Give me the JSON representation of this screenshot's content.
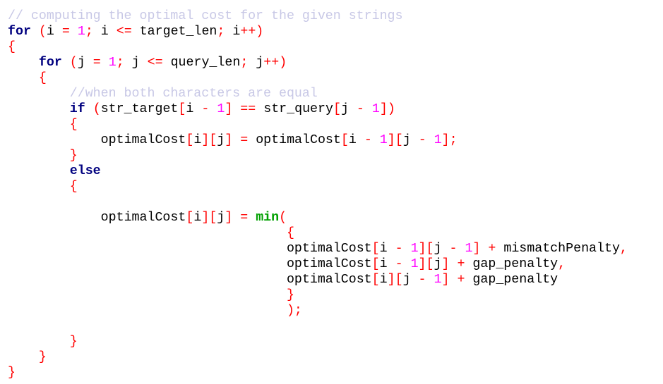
{
  "colors": {
    "keyword": "#00007f",
    "function": "#00a000",
    "number": "#ff00ff",
    "operator": "#ff0000",
    "comment": "#c8c8e6",
    "identifier": "#000000",
    "background": "#ffffff"
  },
  "code_lines": [
    [
      [
        "cmt",
        "// computing the optimal cost for the given strings"
      ]
    ],
    [
      [
        "kw",
        "for"
      ],
      [
        "ws",
        " "
      ],
      [
        "op",
        "("
      ],
      [
        "id",
        "i"
      ],
      [
        "ws",
        " "
      ],
      [
        "op",
        "="
      ],
      [
        "ws",
        " "
      ],
      [
        "num",
        "1"
      ],
      [
        "op",
        ";"
      ],
      [
        "ws",
        " "
      ],
      [
        "id",
        "i"
      ],
      [
        "ws",
        " "
      ],
      [
        "op",
        "<="
      ],
      [
        "ws",
        " "
      ],
      [
        "id",
        "target_len"
      ],
      [
        "op",
        ";"
      ],
      [
        "ws",
        " "
      ],
      [
        "id",
        "i"
      ],
      [
        "op",
        "++)"
      ]
    ],
    [
      [
        "op",
        "{"
      ]
    ],
    [
      [
        "ws",
        "    "
      ],
      [
        "kw",
        "for"
      ],
      [
        "ws",
        " "
      ],
      [
        "op",
        "("
      ],
      [
        "id",
        "j"
      ],
      [
        "ws",
        " "
      ],
      [
        "op",
        "="
      ],
      [
        "ws",
        " "
      ],
      [
        "num",
        "1"
      ],
      [
        "op",
        ";"
      ],
      [
        "ws",
        " "
      ],
      [
        "id",
        "j"
      ],
      [
        "ws",
        " "
      ],
      [
        "op",
        "<="
      ],
      [
        "ws",
        " "
      ],
      [
        "id",
        "query_len"
      ],
      [
        "op",
        ";"
      ],
      [
        "ws",
        " "
      ],
      [
        "id",
        "j"
      ],
      [
        "op",
        "++)"
      ]
    ],
    [
      [
        "ws",
        "    "
      ],
      [
        "op",
        "{"
      ]
    ],
    [
      [
        "ws",
        "        "
      ],
      [
        "cmt",
        "//when both characters are equal"
      ]
    ],
    [
      [
        "ws",
        "        "
      ],
      [
        "kw",
        "if"
      ],
      [
        "ws",
        " "
      ],
      [
        "op",
        "("
      ],
      [
        "id",
        "str_target"
      ],
      [
        "op",
        "["
      ],
      [
        "id",
        "i"
      ],
      [
        "ws",
        " "
      ],
      [
        "op",
        "-"
      ],
      [
        "ws",
        " "
      ],
      [
        "num",
        "1"
      ],
      [
        "op",
        "]"
      ],
      [
        "ws",
        " "
      ],
      [
        "op",
        "=="
      ],
      [
        "ws",
        " "
      ],
      [
        "id",
        "str_query"
      ],
      [
        "op",
        "["
      ],
      [
        "id",
        "j"
      ],
      [
        "ws",
        " "
      ],
      [
        "op",
        "-"
      ],
      [
        "ws",
        " "
      ],
      [
        "num",
        "1"
      ],
      [
        "op",
        "])"
      ]
    ],
    [
      [
        "ws",
        "        "
      ],
      [
        "op",
        "{"
      ]
    ],
    [
      [
        "ws",
        "            "
      ],
      [
        "id",
        "optimalCost"
      ],
      [
        "op",
        "["
      ],
      [
        "id",
        "i"
      ],
      [
        "op",
        "]["
      ],
      [
        "id",
        "j"
      ],
      [
        "op",
        "]"
      ],
      [
        "ws",
        " "
      ],
      [
        "op",
        "="
      ],
      [
        "ws",
        " "
      ],
      [
        "id",
        "optimalCost"
      ],
      [
        "op",
        "["
      ],
      [
        "id",
        "i"
      ],
      [
        "ws",
        " "
      ],
      [
        "op",
        "-"
      ],
      [
        "ws",
        " "
      ],
      [
        "num",
        "1"
      ],
      [
        "op",
        "]["
      ],
      [
        "id",
        "j"
      ],
      [
        "ws",
        " "
      ],
      [
        "op",
        "-"
      ],
      [
        "ws",
        " "
      ],
      [
        "num",
        "1"
      ],
      [
        "op",
        "];"
      ]
    ],
    [
      [
        "ws",
        "        "
      ],
      [
        "op",
        "}"
      ]
    ],
    [
      [
        "ws",
        "        "
      ],
      [
        "kw",
        "else"
      ]
    ],
    [
      [
        "ws",
        "        "
      ],
      [
        "op",
        "{"
      ]
    ],
    [],
    [
      [
        "ws",
        "            "
      ],
      [
        "id",
        "optimalCost"
      ],
      [
        "op",
        "["
      ],
      [
        "id",
        "i"
      ],
      [
        "op",
        "]["
      ],
      [
        "id",
        "j"
      ],
      [
        "op",
        "]"
      ],
      [
        "ws",
        " "
      ],
      [
        "op",
        "="
      ],
      [
        "ws",
        " "
      ],
      [
        "fn",
        "min"
      ],
      [
        "op",
        "("
      ]
    ],
    [
      [
        "ws",
        "                                    "
      ],
      [
        "op",
        "{"
      ]
    ],
    [
      [
        "ws",
        "                                    "
      ],
      [
        "id",
        "optimalCost"
      ],
      [
        "op",
        "["
      ],
      [
        "id",
        "i"
      ],
      [
        "ws",
        " "
      ],
      [
        "op",
        "-"
      ],
      [
        "ws",
        " "
      ],
      [
        "num",
        "1"
      ],
      [
        "op",
        "]["
      ],
      [
        "id",
        "j"
      ],
      [
        "ws",
        " "
      ],
      [
        "op",
        "-"
      ],
      [
        "ws",
        " "
      ],
      [
        "num",
        "1"
      ],
      [
        "op",
        "]"
      ],
      [
        "ws",
        " "
      ],
      [
        "op",
        "+"
      ],
      [
        "ws",
        " "
      ],
      [
        "id",
        "mismatchPenalty"
      ],
      [
        "op",
        ","
      ]
    ],
    [
      [
        "ws",
        "                                    "
      ],
      [
        "id",
        "optimalCost"
      ],
      [
        "op",
        "["
      ],
      [
        "id",
        "i"
      ],
      [
        "ws",
        " "
      ],
      [
        "op",
        "-"
      ],
      [
        "ws",
        " "
      ],
      [
        "num",
        "1"
      ],
      [
        "op",
        "]["
      ],
      [
        "id",
        "j"
      ],
      [
        "op",
        "]"
      ],
      [
        "ws",
        " "
      ],
      [
        "op",
        "+"
      ],
      [
        "ws",
        " "
      ],
      [
        "id",
        "gap_penalty"
      ],
      [
        "op",
        ","
      ]
    ],
    [
      [
        "ws",
        "                                    "
      ],
      [
        "id",
        "optimalCost"
      ],
      [
        "op",
        "["
      ],
      [
        "id",
        "i"
      ],
      [
        "op",
        "]["
      ],
      [
        "id",
        "j"
      ],
      [
        "ws",
        " "
      ],
      [
        "op",
        "-"
      ],
      [
        "ws",
        " "
      ],
      [
        "num",
        "1"
      ],
      [
        "op",
        "]"
      ],
      [
        "ws",
        " "
      ],
      [
        "op",
        "+"
      ],
      [
        "ws",
        " "
      ],
      [
        "id",
        "gap_penalty"
      ]
    ],
    [
      [
        "ws",
        "                                    "
      ],
      [
        "op",
        "}"
      ]
    ],
    [
      [
        "ws",
        "                                    "
      ],
      [
        "op",
        ");"
      ]
    ],
    [],
    [
      [
        "ws",
        "        "
      ],
      [
        "op",
        "}"
      ]
    ],
    [
      [
        "ws",
        "    "
      ],
      [
        "op",
        "}"
      ]
    ],
    [
      [
        "op",
        "}"
      ]
    ]
  ]
}
